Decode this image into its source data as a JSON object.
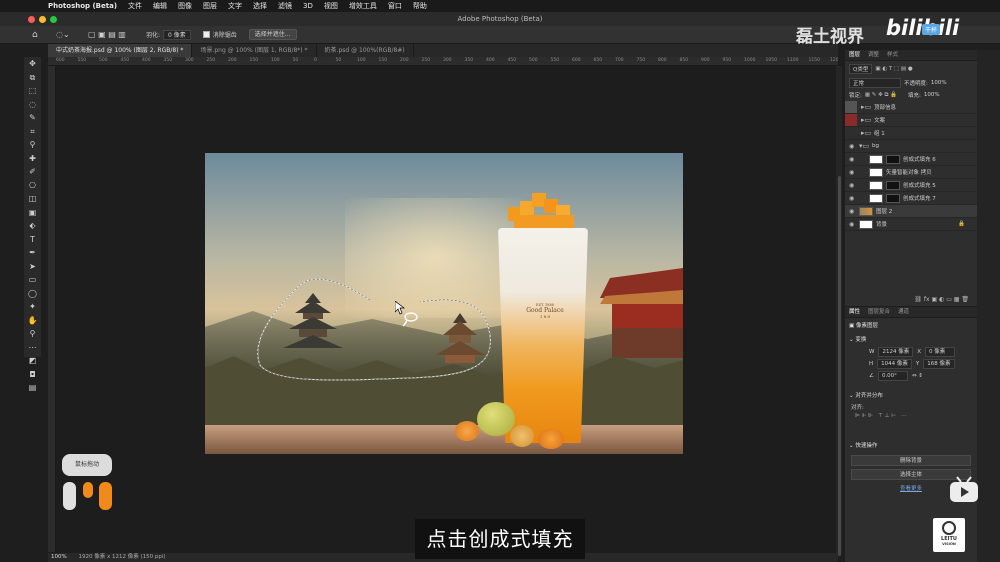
{
  "menubar": {
    "app": "Photoshop (Beta)",
    "items": [
      "文件",
      "编辑",
      "图像",
      "图层",
      "文字",
      "选择",
      "滤镜",
      "3D",
      "视图",
      "增效工具",
      "窗口",
      "帮助"
    ]
  },
  "window": {
    "title": "Adobe Photoshop (Beta)"
  },
  "options": {
    "feather_label": "羽化:",
    "feather_value": "0 像素",
    "antialias_label": "消除锯齿",
    "select_mask_button": "选择并遮住..."
  },
  "tabs": [
    "中式奶茶海报.psd @ 100% (图层 2, RGB/8) *",
    "场景.png @ 100% (图层 1, RGB/8*) *",
    "奶茶.psd @ 100%(RGB/8#)"
  ],
  "ruler": [
    "600",
    "550",
    "500",
    "450",
    "400",
    "350",
    "300",
    "250",
    "200",
    "150",
    "100",
    "50",
    "0",
    "50",
    "100",
    "150",
    "200",
    "250",
    "300",
    "350",
    "400",
    "450",
    "500",
    "550",
    "600",
    "650",
    "700",
    "750",
    "800",
    "850",
    "900",
    "950",
    "1000",
    "1050",
    "1100",
    "1150",
    "1200",
    "1250"
  ],
  "layers_panel": {
    "tabs": [
      "图层",
      "调整",
      "样式"
    ],
    "filter_label": "Q类型",
    "blend_mode": "正常",
    "opacity_label": "不透明度:",
    "opacity_value": "100%",
    "lock_label": "锁定:",
    "fill_label": "填充:",
    "fill_value": "100%",
    "layers": [
      {
        "name": "顶部信息",
        "kind": "folder",
        "visible": false,
        "swatch": "#555555"
      },
      {
        "name": "文案",
        "kind": "folder",
        "visible": false,
        "swatch": "#8a2b2b"
      },
      {
        "name": "组 1",
        "kind": "folder",
        "visible": false,
        "swatch": ""
      },
      {
        "name": "bg",
        "kind": "folder",
        "visible": true,
        "swatch": ""
      },
      {
        "name": "创成式填充 6",
        "kind": "masked",
        "visible": true,
        "swatch": ""
      },
      {
        "name": "矢量智能对象 拷贝",
        "kind": "smart",
        "visible": true,
        "swatch": ""
      },
      {
        "name": "创成式填充 5",
        "kind": "masked",
        "visible": true,
        "swatch": ""
      },
      {
        "name": "创成式填充 7",
        "kind": "masked",
        "visible": true,
        "swatch": ""
      },
      {
        "name": "图层 2",
        "kind": "image",
        "visible": true,
        "swatch": "",
        "selected": true
      },
      {
        "name": "背景",
        "kind": "background",
        "visible": true,
        "swatch": ""
      }
    ]
  },
  "properties_panel": {
    "tabs": [
      "属性",
      "图层复合",
      "通道"
    ],
    "layer_type": "像素图层",
    "transform_title": "变换",
    "w_label": "W",
    "w_value": "2124 像素",
    "x_label": "X",
    "x_value": "0 像素",
    "h_label": "H",
    "h_value": "1044 像素",
    "y_label": "Y",
    "y_value": "168 像素",
    "angle_value": "0.00°",
    "align_title": "对齐并分布",
    "align_label": "对齐:",
    "quick_title": "快速操作",
    "remove_bg": "删除背景",
    "select_subject": "选择主体",
    "view_more": "查看更多"
  },
  "status": {
    "zoom": "100%",
    "doc_info": "1920 像素 x 1212 像素 (150 ppi)"
  },
  "canvas": {
    "cup_brand": "Good Palace",
    "cup_small": "EST. 1888",
    "cup_char": "1 8 8"
  },
  "overlay": {
    "drag_badge": "鼠标拖动",
    "subtitle": "点击创成式填充",
    "watermark": "磊土视界",
    "bili_logo": "bilibili",
    "bili_badge": "干杯",
    "leitu_text": "LEITU",
    "leitu_sub": "VISION"
  }
}
